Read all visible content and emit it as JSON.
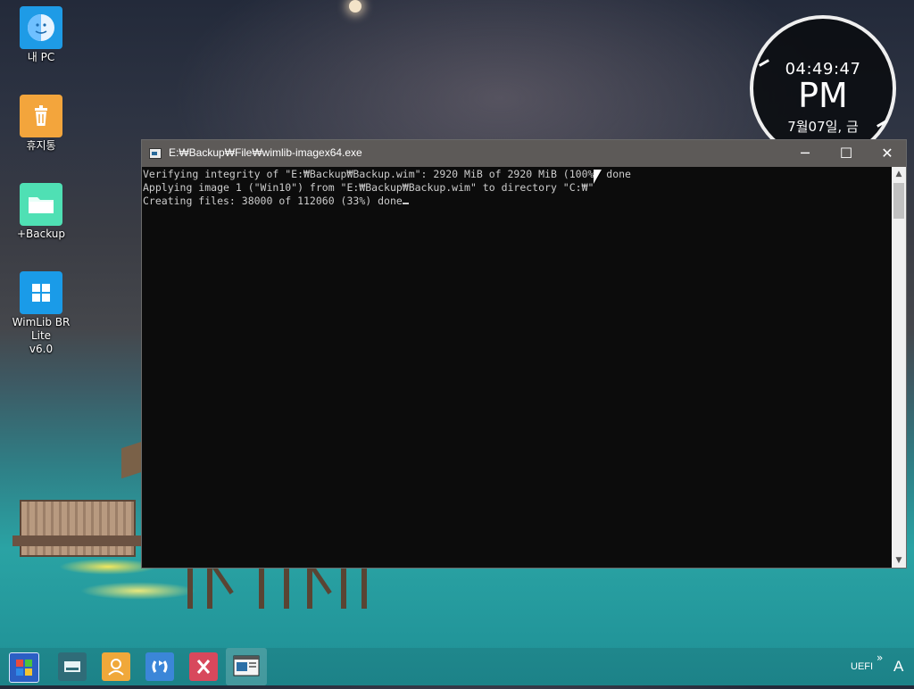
{
  "desktop": {
    "icons": [
      {
        "label": "내 PC"
      },
      {
        "label": "휴지통"
      },
      {
        "label": "+Backup"
      },
      {
        "label": "WimLib BR Lite\nv6.0"
      }
    ]
  },
  "clock": {
    "time": "04:49:47",
    "ampm": "PM",
    "date": "7월07일, 금"
  },
  "window": {
    "title": "E:₩Backup₩File₩wimlib-imagex64.exe",
    "minimize": "─",
    "maximize": "☐",
    "close": "✕",
    "lines": [
      "Verifying integrity of \"E:₩Backup₩Backup.wim\": 2920 MiB of 2920 MiB (100%) done",
      "Applying image 1 (\"Win10\") from \"E:₩Backup₩Backup.wim\" to directory \"C:₩\"",
      "Creating files: 38000 of 112060 (33%) done"
    ]
  },
  "taskbar": {
    "tray_uefi": "UEFI",
    "tray_chevron": "»",
    "tray_ime": "A"
  }
}
